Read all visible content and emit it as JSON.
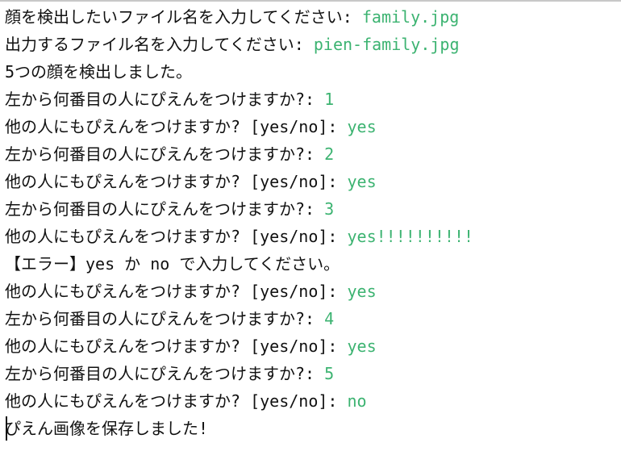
{
  "colors": {
    "background": "#ffffff",
    "text": "#111111",
    "input": "#3cb371"
  },
  "lines": [
    {
      "prompt": "顔を検出したいファイル名を入力してください: ",
      "input": "family.jpg"
    },
    {
      "prompt": "出力するファイル名を入力してください: ",
      "input": "pien-family.jpg"
    },
    {
      "prompt": "5つの顔を検出しました。",
      "input": ""
    },
    {
      "prompt": "左から何番目の人にぴえんをつけますか?: ",
      "input": "1"
    },
    {
      "prompt": "他の人にもぴえんをつけますか? [yes/no]: ",
      "input": "yes"
    },
    {
      "prompt": "左から何番目の人にぴえんをつけますか?: ",
      "input": "2"
    },
    {
      "prompt": "他の人にもぴえんをつけますか? [yes/no]: ",
      "input": "yes"
    },
    {
      "prompt": "左から何番目の人にぴえんをつけますか?: ",
      "input": "3"
    },
    {
      "prompt": "他の人にもぴえんをつけますか? [yes/no]: ",
      "input": "yes!!!!!!!!!!"
    },
    {
      "prompt": "【エラー】yes か no で入力してください。",
      "input": ""
    },
    {
      "prompt": "他の人にもぴえんをつけますか? [yes/no]: ",
      "input": "yes"
    },
    {
      "prompt": "左から何番目の人にぴえんをつけますか?: ",
      "input": "4"
    },
    {
      "prompt": "他の人にもぴえんをつけますか? [yes/no]: ",
      "input": "yes"
    },
    {
      "prompt": "左から何番目の人にぴえんをつけますか?: ",
      "input": "5"
    },
    {
      "prompt": "他の人にもぴえんをつけますか? [yes/no]: ",
      "input": "no"
    },
    {
      "prompt": "ぴえん画像を保存しました!",
      "input": ""
    }
  ]
}
